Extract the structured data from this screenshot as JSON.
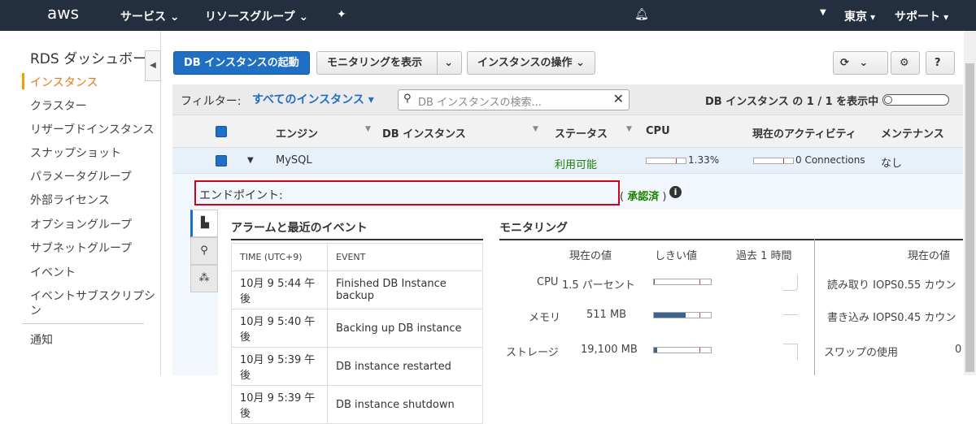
{
  "nav": {
    "logo": "aws",
    "services": "サービス",
    "resource_groups": "リソースグループ",
    "region": "東京",
    "support": "サポート"
  },
  "sidebar": {
    "title": "RDS ダッシュボー",
    "items": [
      "インスタンス",
      "クラスター",
      "リザーブドインスタンス",
      "スナップショット",
      "パラメータグループ",
      "外部ライセンス",
      "オプショングループ",
      "サブネットグループ",
      "イベント",
      "イベントサブスクリプシ",
      "ン"
    ],
    "notifications": "通知"
  },
  "toolbar": {
    "launch": "DB インスタンスの起動",
    "show_monitoring": "モニタリングを表示",
    "instance_actions": "インスタンスの操作"
  },
  "filter": {
    "label": "フィルター:",
    "value": "すべてのインスタンス",
    "search_placeholder": "DB インスタンスの検索...",
    "count": "DB インスタンス の 1 / 1 を表示中"
  },
  "table": {
    "headers": [
      "エンジン",
      "DB インスタンス",
      "ステータス",
      "CPU",
      "現在のアクティビティ",
      "メンテナンス"
    ],
    "row": {
      "engine": "MySQL",
      "status": "利用可能",
      "cpu": "1.33%",
      "activity": "0 Connections",
      "maintenance": "なし"
    }
  },
  "detail": {
    "endpoint_label": "エンドポイント:",
    "endpoint_status": "承認済",
    "alarms": {
      "title": "アラームと最近のイベント",
      "headers": [
        "TIME (UTC+9)",
        "EVENT"
      ],
      "rows": [
        [
          "10月 9 5:44 午後",
          "Finished DB Instance backup"
        ],
        [
          "10月 9 5:40 午後",
          "Backing up DB instance"
        ],
        [
          "10月 9 5:39 午後",
          "DB instance restarted"
        ],
        [
          "10月 9 5:39 午後",
          "DB instance shutdown"
        ]
      ]
    },
    "monitoring": {
      "title": "モニタリング",
      "headers": [
        "現在の値",
        "しきい値",
        "過去 1 時間"
      ],
      "right_header": "現在の値",
      "metrics": [
        {
          "name": "CPU",
          "value": "1.5 パーセント",
          "fill": 0.02
        },
        {
          "name": "メモリ",
          "value": "511 MB",
          "fill": 0.55
        },
        {
          "name": "ストレージ",
          "value": "19,100 MB",
          "fill": 0.05
        }
      ],
      "right": [
        {
          "name": "読み取り IOPS",
          "value": "0.55 カウン"
        },
        {
          "name": "書き込み IOPS",
          "value": "0.45 カウン"
        },
        {
          "name": "スワップの使用",
          "value": "0"
        }
      ]
    }
  },
  "colors": {
    "nav": "#232f3e",
    "primary": "#1f6fc5",
    "ok": "#1d8102",
    "highlight": "#d0021b"
  }
}
